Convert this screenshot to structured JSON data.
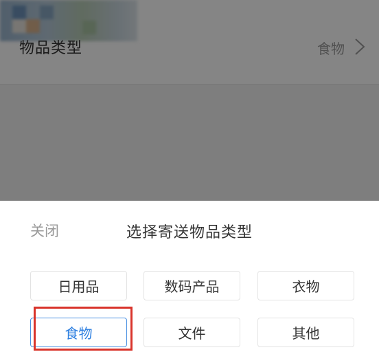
{
  "background_page": {
    "row_label": "物品类型",
    "row_value": "食物"
  },
  "sheet": {
    "close_label": "关闭",
    "title": "选择寄送物品类型",
    "options": [
      {
        "label": "日用品",
        "selected": false
      },
      {
        "label": "数码产品",
        "selected": false
      },
      {
        "label": "衣物",
        "selected": false
      },
      {
        "label": "食物",
        "selected": true
      },
      {
        "label": "文件",
        "selected": false
      },
      {
        "label": "其他",
        "selected": false
      }
    ]
  },
  "colors": {
    "accent": "#4a90e2",
    "annotation_red": "#d9342b",
    "overlay": "rgba(0,0,0,0.48)"
  }
}
